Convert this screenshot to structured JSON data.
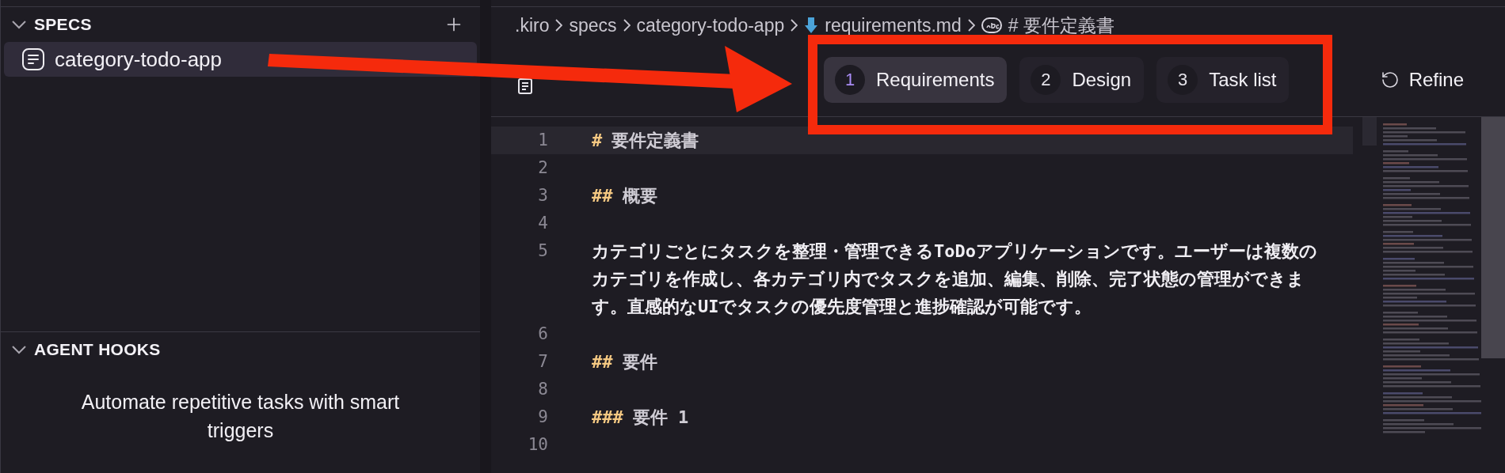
{
  "sidebar": {
    "sections": [
      {
        "kind": "list",
        "title": "SPECS",
        "expanded": true,
        "items": [
          {
            "label": "category-todo-app",
            "selected": true
          }
        ]
      },
      {
        "kind": "message",
        "title": "AGENT HOOKS",
        "expanded": true,
        "message": "Automate repetitive tasks with smart triggers"
      }
    ]
  },
  "breadcrumb": [
    {
      "kind": "folder",
      "label": ".kiro"
    },
    {
      "kind": "folder",
      "label": "specs"
    },
    {
      "kind": "folder",
      "label": "category-todo-app"
    },
    {
      "kind": "file",
      "label": "requirements.md"
    },
    {
      "kind": "symbol",
      "label": "# 要件定義書"
    }
  ],
  "spec_toolbar": {
    "steps": [
      {
        "number": "1",
        "label": "Requirements",
        "selected": true
      },
      {
        "number": "2",
        "label": "Design",
        "selected": false
      },
      {
        "number": "3",
        "label": "Task list",
        "selected": false
      }
    ],
    "refine": "Refine"
  },
  "editor": {
    "lines": [
      {
        "number": "1",
        "marker": "#",
        "text": "要件定義書",
        "current": true
      },
      {
        "number": "2",
        "current": false
      },
      {
        "number": "3",
        "marker": "##",
        "text": "概要",
        "current": false
      },
      {
        "number": "4",
        "current": false
      },
      {
        "number": "5",
        "text": "カテゴリごとにタスクを整理・管理できるToDoアプリケーションです。ユーザーは複数のカテゴリを作成し、各カテゴリ内でタスクを追加、編集、削除、完了状態の管理ができます。直感的なUIでタスクの優先度管理と進捗確認が可能です。",
        "current": false
      },
      {
        "number": "6",
        "current": false
      },
      {
        "number": "7",
        "marker": "##",
        "text": "要件",
        "current": false
      },
      {
        "number": "8",
        "current": false
      },
      {
        "number": "9",
        "marker": "###",
        "text": "要件 1",
        "current": false
      },
      {
        "number": "10",
        "current": false
      }
    ]
  },
  "annotations": {
    "arrow": true,
    "highlight_frame": true
  }
}
